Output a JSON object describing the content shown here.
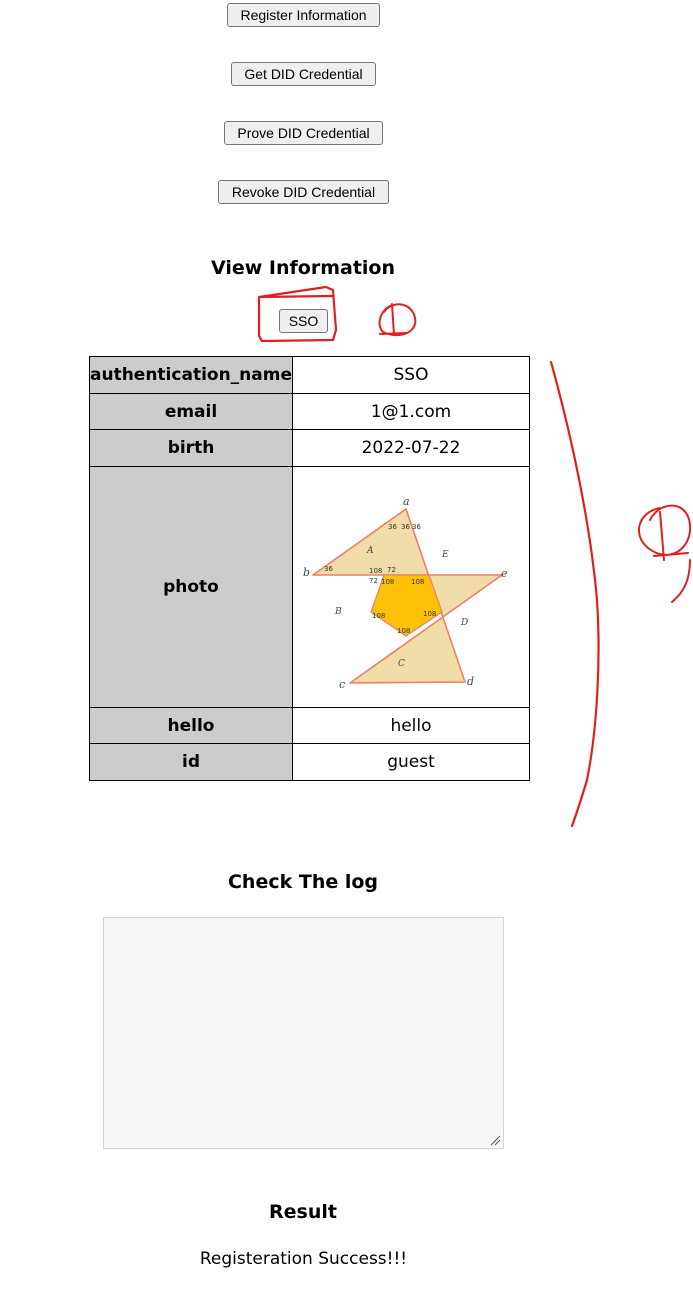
{
  "buttons": {
    "register": "Register Information",
    "get_did": "Get DID Credential",
    "prove_did": "Prove DID Credential",
    "revoke_did": "Revoke DID Credential",
    "sso": "SSO"
  },
  "view": {
    "heading": "View Information",
    "rows": [
      {
        "key": "authentication_name",
        "value": "SSO"
      },
      {
        "key": "email",
        "value": "1@1.com"
      },
      {
        "key": "birth",
        "value": "2022-07-22"
      },
      {
        "key": "photo",
        "value": ""
      },
      {
        "key": "hello",
        "value": "hello"
      },
      {
        "key": "id",
        "value": "guest"
      }
    ]
  },
  "photo_figure": {
    "vertex_labels": [
      "a",
      "b",
      "c",
      "d",
      "e"
    ],
    "region_labels": [
      "A",
      "B",
      "C",
      "D",
      "E"
    ],
    "angle_labels": {
      "tip": [
        "36",
        "36",
        "36",
        "36"
      ],
      "side": [
        "108",
        "72",
        "72",
        "108"
      ],
      "inner": [
        "108",
        "108",
        "108",
        "108",
        "108"
      ]
    },
    "colors": {
      "outer_fill": "#efdca6",
      "inner_fill": "#ffc107",
      "stroke": "#e9806b"
    }
  },
  "log": {
    "heading": "Check The log",
    "value": ""
  },
  "result": {
    "heading": "Result",
    "text": "Registeration Success!!!"
  },
  "annotations": {
    "marker_color": "#e02020",
    "labels": [
      "1",
      "1"
    ]
  }
}
